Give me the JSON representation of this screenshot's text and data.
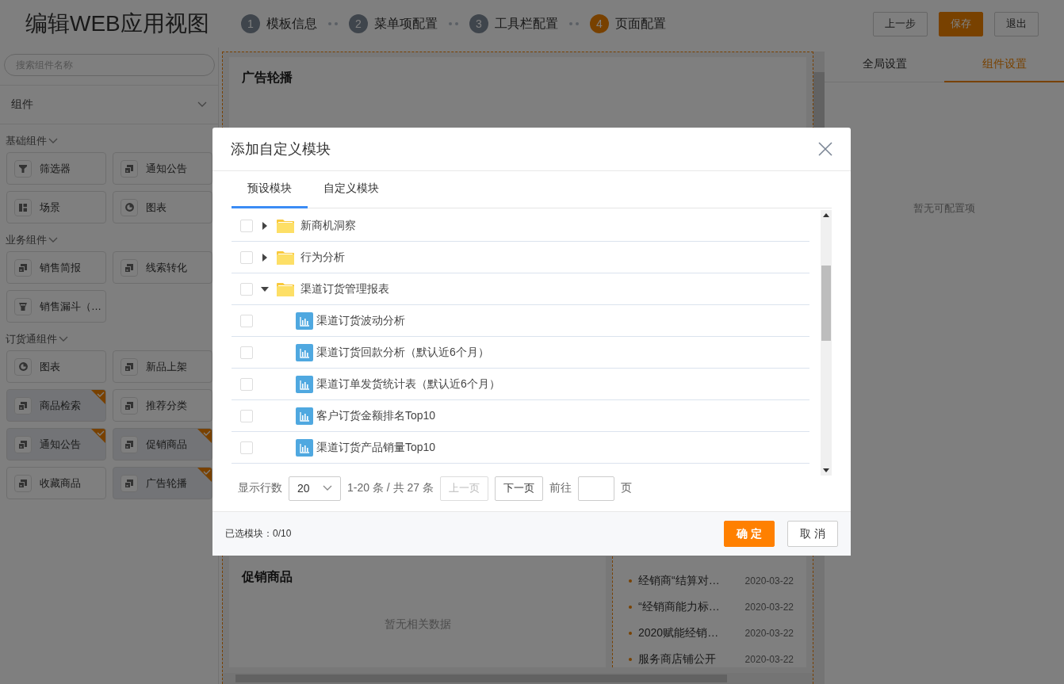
{
  "header": {
    "title": "编辑WEB应用视图",
    "steps": [
      {
        "number": "1",
        "label": "模板信息",
        "selected": false
      },
      {
        "number": "2",
        "label": "菜单项配置",
        "selected": false
      },
      {
        "number": "3",
        "label": "工具栏配置",
        "selected": false
      },
      {
        "number": "4",
        "label": "页面配置",
        "selected": true
      }
    ],
    "buttons": [
      {
        "label": "上一步",
        "kind": "default"
      },
      {
        "label": "保存",
        "kind": "primary"
      },
      {
        "label": "退出",
        "kind": "default"
      }
    ]
  },
  "sidebar": {
    "search": {
      "placeholder": "搜索组件名称"
    },
    "dropdown": {
      "label": "组件"
    },
    "groups": [
      {
        "title": "基础组件",
        "items": [
          {
            "label": "筛选器",
            "kind": "filter",
            "selected": false
          },
          {
            "label": "通知公告",
            "kind": "module",
            "selected": false
          },
          {
            "label": "场景",
            "kind": "layout",
            "selected": false
          },
          {
            "label": "图表",
            "kind": "pie",
            "selected": false
          }
        ]
      },
      {
        "title": "业务组件",
        "items": [
          {
            "label": "销售简报",
            "kind": "module",
            "selected": false
          },
          {
            "label": "线索转化",
            "kind": "module",
            "selected": false
          },
          {
            "label": "销售漏斗（…",
            "kind": "funnel",
            "selected": false
          }
        ]
      },
      {
        "title": "订货通组件",
        "items": [
          {
            "label": "图表",
            "kind": "pie",
            "selected": false
          },
          {
            "label": "新品上架",
            "kind": "module",
            "selected": false
          },
          {
            "label": "商品检索",
            "kind": "module",
            "selected": true
          },
          {
            "label": "推荐分类",
            "kind": "module",
            "selected": false
          },
          {
            "label": "通知公告",
            "kind": "module",
            "selected": true
          },
          {
            "label": "促销商品",
            "kind": "module",
            "selected": true
          },
          {
            "label": "收藏商品",
            "kind": "module",
            "selected": false
          },
          {
            "label": "广告轮播",
            "kind": "module",
            "selected": true
          }
        ]
      }
    ]
  },
  "canvas": {
    "ad_card": {
      "title": "广告轮播"
    },
    "promo_card": {
      "title": "促销商品",
      "empty": "暂无相关数据"
    },
    "news": [
      {
        "text": "经销商“结算对…",
        "date": "2020-03-22"
      },
      {
        "text": "“经销商能力标…",
        "date": "2020-03-22"
      },
      {
        "text": "2020赋能经销…",
        "date": "2020-03-22"
      },
      {
        "text": "服务商店铺公开",
        "date": "2020-03-22"
      }
    ]
  },
  "settings": {
    "tabs": [
      {
        "label": "全局设置",
        "selected": false
      },
      {
        "label": "组件设置",
        "selected": true
      }
    ],
    "empty": "暂无可配置项"
  },
  "dialog": {
    "title": "添加自定义模块",
    "tabs": [
      {
        "label": "预设模块",
        "selected": true
      },
      {
        "label": "自定义模块",
        "selected": false
      }
    ],
    "tree": [
      {
        "label": "新商机洞察",
        "kind": "folder",
        "checked": false,
        "expanded": false
      },
      {
        "label": "行为分析",
        "kind": "folder",
        "checked": false,
        "expanded": false
      },
      {
        "label": "渠道订货管理报表",
        "kind": "folder",
        "checked": false,
        "expanded": true,
        "children": [
          {
            "label": "渠道订货波动分析",
            "kind": "report",
            "checked": false
          },
          {
            "label": "渠道订货回款分析（默认近6个月）",
            "kind": "report",
            "checked": false
          },
          {
            "label": "渠道订单发货统计表（默认近6个月）",
            "kind": "report",
            "checked": false
          },
          {
            "label": "客户订货金额排名Top10",
            "kind": "report",
            "checked": false
          },
          {
            "label": "渠道订货产品销量Top10",
            "kind": "report",
            "checked": false
          }
        ]
      }
    ],
    "pagination": {
      "rows_label": "显示行数",
      "rows_value": "20",
      "range": "1-20 条 / 共 27 条",
      "buttons": [
        {
          "label": "上一页",
          "disabled": true
        },
        {
          "label": "下一页",
          "disabled": false
        }
      ],
      "goto_label": "前往",
      "page_suffix": "页"
    },
    "selected_count": "已选模块：0/10",
    "buttons": [
      {
        "label": "确 定",
        "kind": "primary"
      },
      {
        "label": "取 消",
        "kind": "default"
      }
    ]
  }
}
